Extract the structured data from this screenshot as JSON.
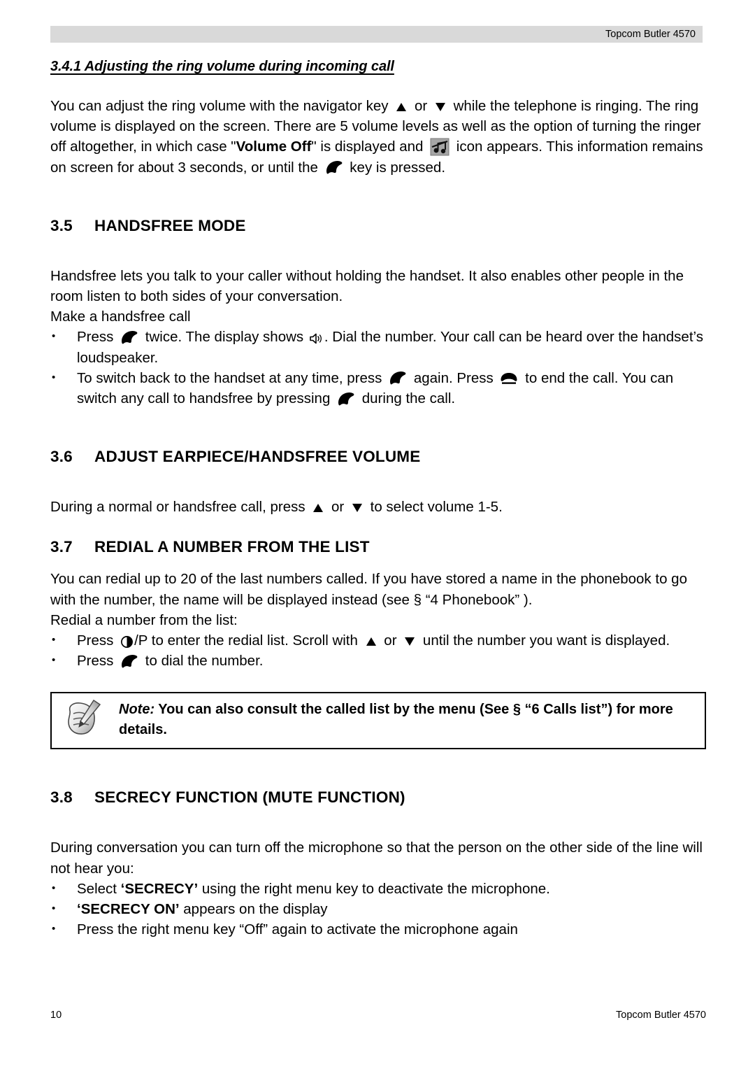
{
  "header": {
    "running_title": "Topcom Butler 4570"
  },
  "footer": {
    "page_number": "10",
    "running_title": "Topcom Butler 4570"
  },
  "sections": {
    "s341": {
      "heading": "3.4.1 Adjusting the ring volume during incoming call",
      "p1_a": "You can adjust the ring volume with the navigator key ",
      "p1_b": " or ",
      "p1_c": " while the telephone is ringing. The ring volume is displayed on the screen. There are 5 volume levels as well as the option of turning the ringer off altogether, in which case \"",
      "p1_bold": "Volume Off",
      "p1_d": "\" is displayed and ",
      "p1_e": " icon appears. This information remains on screen for about 3 seconds, or until the ",
      "p1_f": " key is pressed."
    },
    "s35": {
      "number": "3.5",
      "title": "HANDSFREE MODE",
      "p1": "Handsfree lets you talk to your caller without holding the handset. It also enables other people in the room listen to both sides of your conversation.",
      "p2": "Make a handsfree call",
      "b1_a": "Press ",
      "b1_b": " twice. The display shows ",
      "b1_c": ". Dial the number. Your call can be heard over the handset’s loudspeaker.",
      "b2_a": "To switch back to the handset at any time, press ",
      "b2_b": " again. Press ",
      "b2_c": " to end the call. You can switch any call to handsfree by pressing ",
      "b2_d": " during the call."
    },
    "s36": {
      "number": "3.6",
      "title": "ADJUST EARPIECE/HANDSFREE VOLUME",
      "p1_a": "During a normal or handsfree call, press ",
      "p1_b": " or ",
      "p1_c": " to select volume 1-5."
    },
    "s37": {
      "number": "3.7",
      "title": "REDIAL A NUMBER FROM THE LIST",
      "p1": "You can redial up to 20 of the last numbers called. If you have stored a name in the phonebook to go with the number, the name will be displayed instead (see § “4 Phonebook” ).",
      "p2": "Redial a number from the list:",
      "b1_a": "Press ",
      "b1_b": "/P to enter the redial list. Scroll with ",
      "b1_c": " or ",
      "b1_d": " until the number you want is displayed.",
      "b2_a": "Press ",
      "b2_b": " to dial the number."
    },
    "note": {
      "label": "Note:",
      "text": " You can also consult the called list by the menu (See § “6 Calls list”) for more details."
    },
    "s38": {
      "number": "3.8",
      "title": "SECRECY FUNCTION (MUTE FUNCTION)",
      "p1": "During conversation you can turn off the microphone so that the person on the other side of the line will not hear you:",
      "b1_a": "Select ",
      "b1_bold": "‘SECRECY’",
      "b1_b": " using the right menu key to deactivate the microphone.",
      "b2_bold": "‘SECRECY ON’",
      "b2_a": " appears on the display",
      "b3": "Press the right menu key “Off” again to activate the microphone again"
    }
  },
  "icons": {
    "nav_up": "triangle-up-icon",
    "nav_down": "triangle-down-icon",
    "call": "handset-call-icon",
    "endcall": "handset-endcall-icon",
    "speaker": "loudspeaker-icon",
    "ringer_off": "ringer-off-icon",
    "redial": "redial-pause-icon",
    "note": "note-pencil-icon"
  },
  "colors": {
    "header_band": "#d9d9d9",
    "text": "#000000",
    "page": "#ffffff",
    "note_border": "#000000"
  }
}
